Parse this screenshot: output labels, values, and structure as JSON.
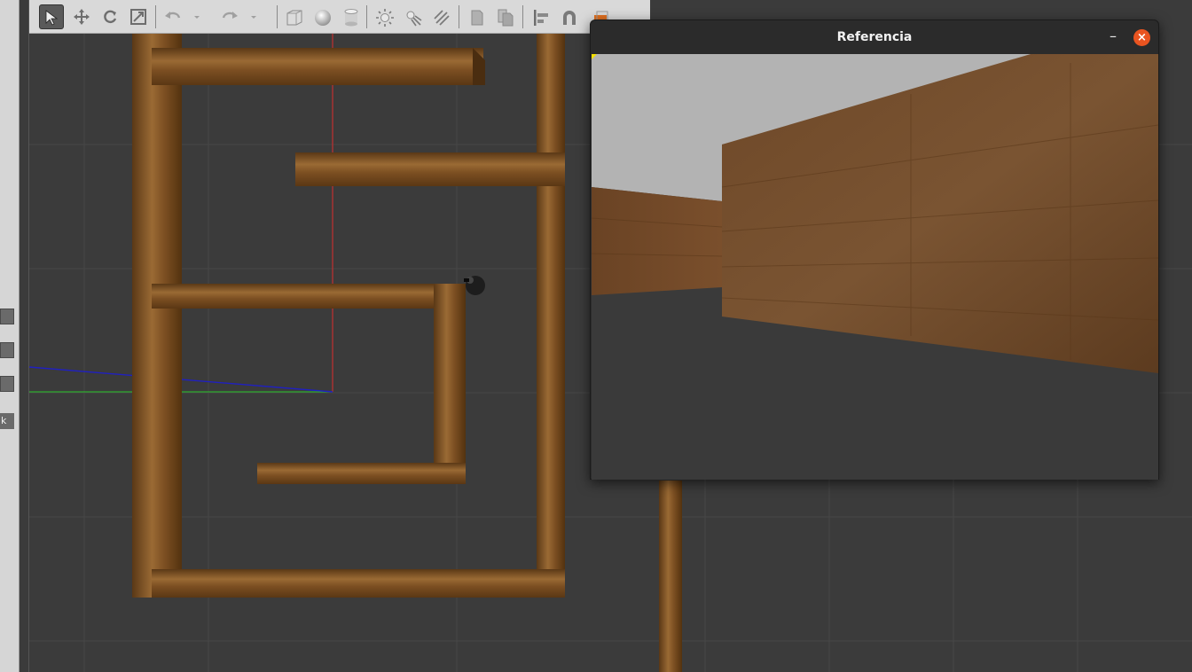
{
  "left_panel": {
    "truncated_label": "k"
  },
  "toolbar": {
    "tools": [
      {
        "name": "select-mode",
        "icon": "arrow-cursor-icon",
        "active": true
      },
      {
        "name": "translate-mode",
        "icon": "move-arrows-icon"
      },
      {
        "name": "rotate-mode",
        "icon": "rotate-icon"
      },
      {
        "name": "scale-mode",
        "icon": "scale-icon"
      },
      {
        "name": "undo",
        "icon": "undo-icon"
      },
      {
        "name": "undo-history",
        "icon": "chevron-down-icon"
      },
      {
        "name": "redo",
        "icon": "redo-icon"
      },
      {
        "name": "redo-history",
        "icon": "chevron-down-icon"
      },
      {
        "name": "insert-box",
        "icon": "box-icon"
      },
      {
        "name": "insert-sphere",
        "icon": "sphere-icon"
      },
      {
        "name": "insert-cylinder",
        "icon": "cylinder-icon"
      },
      {
        "name": "point-light",
        "icon": "sun-icon"
      },
      {
        "name": "spot-light",
        "icon": "spot-light-icon"
      },
      {
        "name": "directional-light",
        "icon": "directional-light-icon"
      },
      {
        "name": "copy",
        "icon": "copy-icon"
      },
      {
        "name": "paste",
        "icon": "paste-icon"
      },
      {
        "name": "align",
        "icon": "align-icon"
      },
      {
        "name": "snap",
        "icon": "magnet-icon"
      },
      {
        "name": "screenshot",
        "icon": "camera-icon"
      }
    ]
  },
  "reference_window": {
    "title": "Referencia",
    "minimize_glyph": "–",
    "close_glyph": "×"
  },
  "colors": {
    "viewport_bg": "#3b3b3b",
    "wood": "#7a4e22",
    "sky": "#b3b3b3",
    "close_button": "#e95420",
    "axis_red": "#c03030",
    "axis_green": "#2eaa2e",
    "axis_blue": "#2020c0"
  }
}
